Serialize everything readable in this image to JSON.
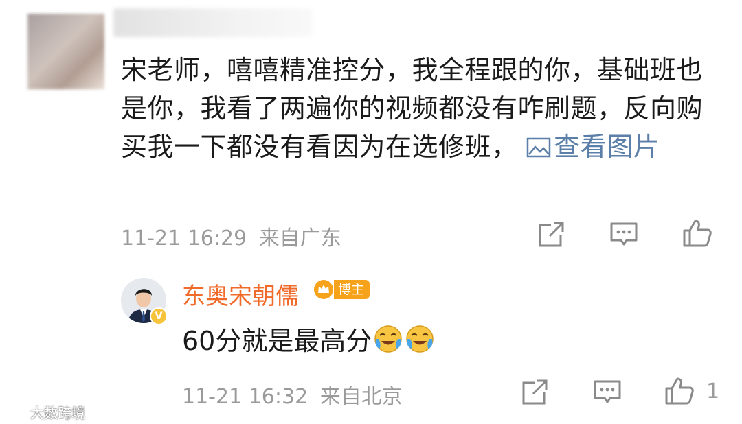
{
  "comment": {
    "text": "宋老师，嘻嘻精准控分，我全程跟的你，基础班也是你，我看了两遍你的视频都没有咋刷题，反向购买我一下都没有看因为在选修班，",
    "see_picture_label": "查看图片",
    "time": "11-21 16:29",
    "location": "来自广东"
  },
  "reply": {
    "author": "东奥宋朝儒",
    "badge": "博主",
    "text": "60分就是最高分",
    "emoji_count": 2,
    "time": "11-21 16:32",
    "location": "来自北京",
    "like_count": "1"
  },
  "watermark": "大数跨境",
  "colors": {
    "link": "#5b7fa8",
    "author": "#f06a2a",
    "badge": "#f6a21a",
    "meta": "#9a9a9a"
  },
  "icons": [
    "share-icon",
    "comment-icon",
    "like-icon",
    "picture-icon",
    "crown-icon",
    "verified-icon",
    "laugh-cry-emoji"
  ]
}
